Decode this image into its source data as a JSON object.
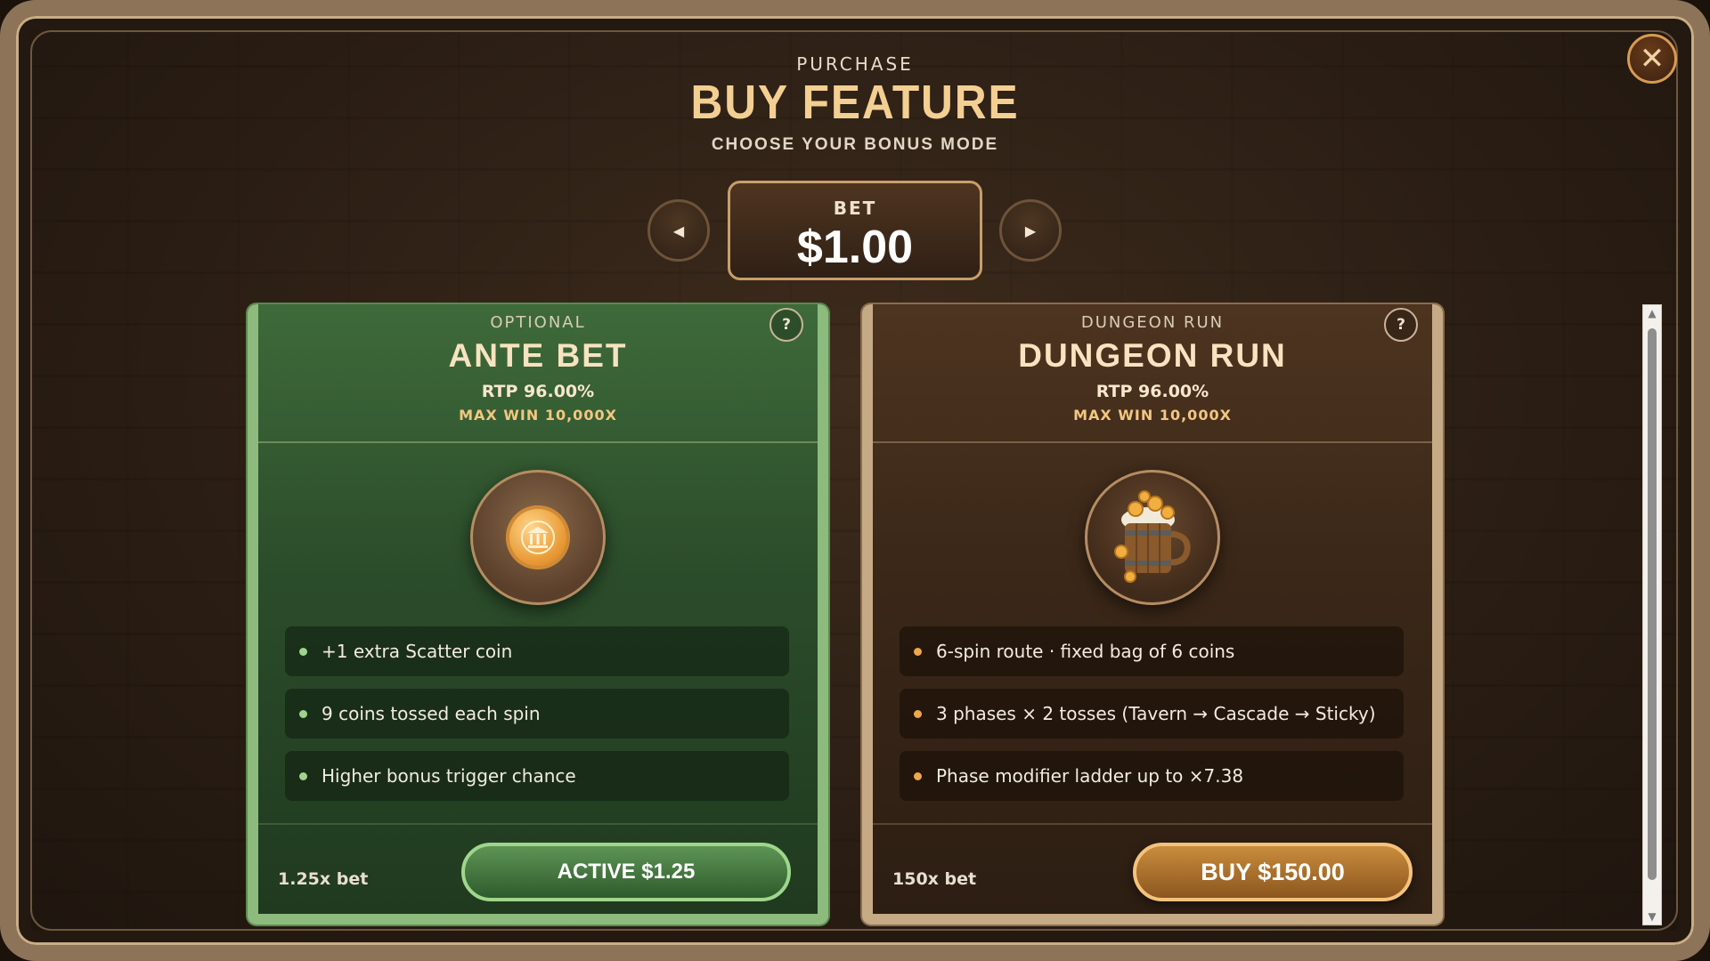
{
  "header": {
    "subtitle": "PURCHASE",
    "title": "BUY FEATURE",
    "caption": "CHOOSE YOUR BONUS MODE"
  },
  "bet": {
    "label": "BET",
    "value": "$1.00",
    "prev_icon": "triangle-left-icon",
    "next_icon": "triangle-right-icon"
  },
  "close_icon": "close-icon",
  "cards": [
    {
      "kicker": "OPTIONAL",
      "title": "ANTE BET",
      "rtp": "RTP 96.00%",
      "max_win": "MAX WIN 10,000X",
      "help": "?",
      "icon": "coin-bank-icon",
      "features": [
        "+1 extra Scatter coin",
        "9 coins tossed each spin",
        "Higher bonus trigger chance"
      ],
      "multiplier": "1.25x bet",
      "action": "ACTIVE $1.25",
      "accent": "#8dbb7e"
    },
    {
      "kicker": "DUNGEON RUN",
      "title": "DUNGEON RUN",
      "rtp": "RTP 96.00%",
      "max_win": "MAX WIN 10,000X",
      "help": "?",
      "icon": "beer-mug-coins-icon",
      "features": [
        "6-spin route · fixed bag of 6 coins",
        "3 phases × 2 tosses (Tavern → Cascade → Sticky)",
        "Phase modifier ladder up to ×7.38"
      ],
      "multiplier": "150x bet",
      "action": "BUY $150.00",
      "accent": "#c6aa86"
    }
  ],
  "colors": {
    "gold_title": "#f4cf92",
    "green_button": "#5e9455",
    "orange_button": "#c98d3d",
    "frame": "#8d7458"
  }
}
